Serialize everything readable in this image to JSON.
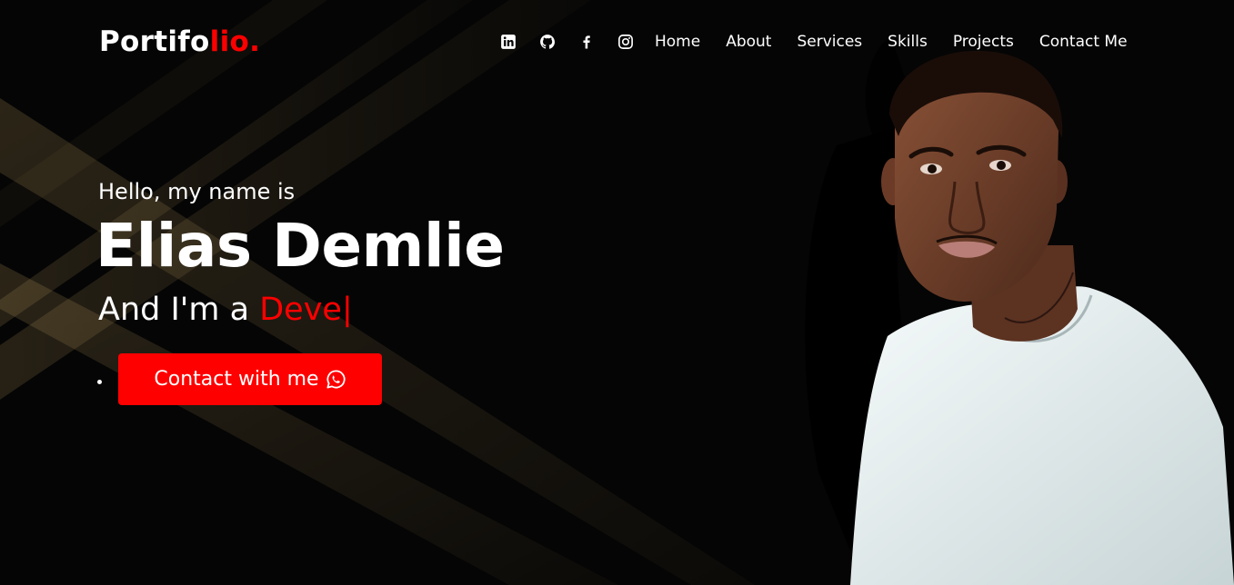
{
  "brand": {
    "logo_main": "Portifo",
    "logo_accent": "lio."
  },
  "nav": {
    "social_icons": [
      "linkedin-icon",
      "github-icon",
      "facebook-icon",
      "instagram-icon"
    ],
    "links": [
      "Home",
      "About",
      "Services",
      "Skills",
      "Projects",
      "Contact Me"
    ]
  },
  "hero": {
    "greeting": "Hello, my name is",
    "name": "Elias Demlie",
    "role_prefix": "And I'm a ",
    "role_typed": "Deve",
    "cursor": "|",
    "cta_label": "Contact with me",
    "cta_icon": "whatsapp-icon"
  },
  "colors": {
    "accent": "#ff0000",
    "background": "#050505",
    "text": "#ffffff",
    "ray": "#d9b36a"
  }
}
